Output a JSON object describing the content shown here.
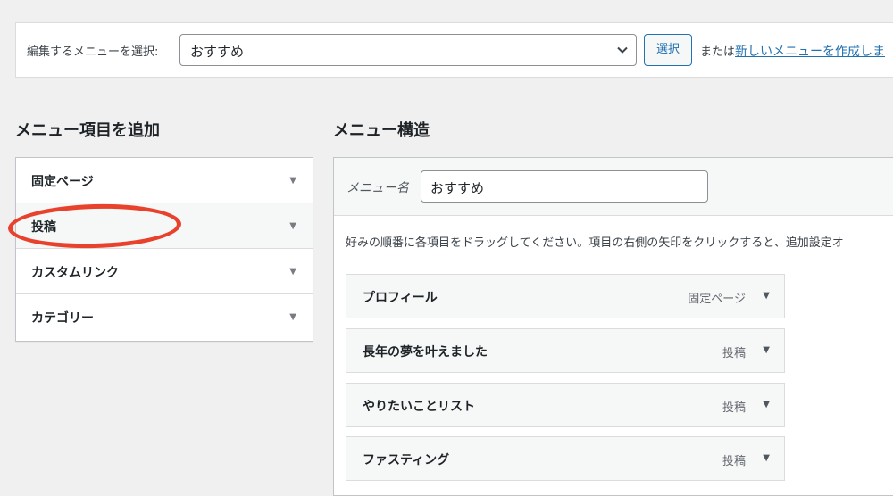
{
  "select_bar": {
    "label": "編集するメニューを選択:",
    "selected": "おすすめ",
    "button": "選択",
    "or_text": "または",
    "create_link": "新しいメニューを作成しま"
  },
  "left": {
    "heading": "メニュー項目を追加",
    "items": [
      {
        "label": "固定ページ"
      },
      {
        "label": "投稿"
      },
      {
        "label": "カスタムリンク"
      },
      {
        "label": "カテゴリー"
      }
    ]
  },
  "right": {
    "heading": "メニュー構造",
    "name_label": "メニュー名",
    "name_value": "おすすめ",
    "instructions": "好みの順番に各項目をドラッグしてください。項目の右側の矢印をクリックすると、追加設定オ",
    "items": [
      {
        "title": "プロフィール",
        "type": "固定ページ"
      },
      {
        "title": "長年の夢を叶えました",
        "type": "投稿"
      },
      {
        "title": "やりたいことリスト",
        "type": "投稿"
      },
      {
        "title": "ファスティング",
        "type": "投稿"
      }
    ]
  },
  "annotation_color": "#e8412c"
}
